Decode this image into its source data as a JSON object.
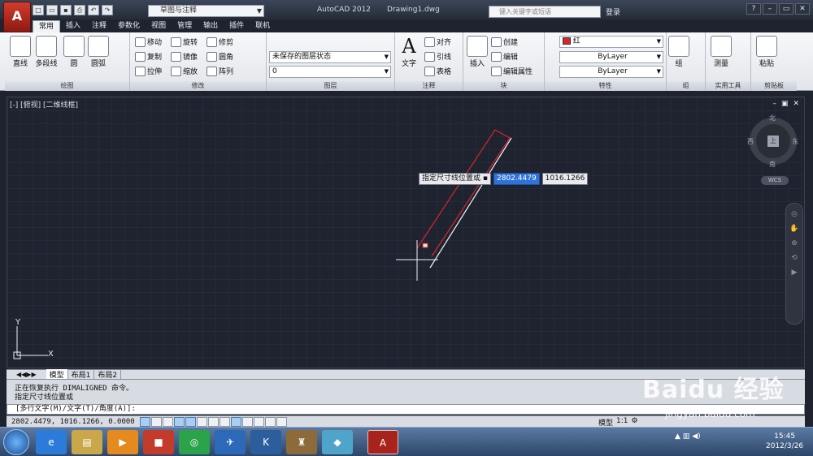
{
  "title": {
    "app": "AutoCAD 2012",
    "file": "Drawing1.dwg",
    "workspace": "草图与注释",
    "search_placeholder": "键入关键字或短语",
    "login": "登录"
  },
  "tabs": [
    "常用",
    "插入",
    "注释",
    "参数化",
    "视图",
    "管理",
    "输出",
    "插件",
    "联机"
  ],
  "ribbon": {
    "draw": {
      "title": "绘图",
      "line": "直线",
      "polyline": "多段线",
      "circle": "圆",
      "arc": "圆弧"
    },
    "modify": {
      "title": "修改",
      "items": [
        "移动",
        "旋转",
        "修剪",
        "复制",
        "镜像",
        "圆角",
        "拉伸",
        "缩放",
        "阵列"
      ]
    },
    "layers": {
      "title": "图层",
      "state": "未保存的图层状态",
      "current": "0"
    },
    "annotation": {
      "title": "注释",
      "text": "文字",
      "align": "对齐",
      "leader": "引线",
      "table": "表格"
    },
    "block": {
      "title": "块",
      "insert": "插入",
      "create": "创建",
      "edit": "编辑",
      "attr": "编辑属性"
    },
    "properties": {
      "title": "特性",
      "color": "红",
      "linetype": "ByLayer",
      "lineweight": "ByLayer"
    },
    "group": {
      "title": "组",
      "label": "组"
    },
    "utilities": {
      "title": "实用工具",
      "measure": "测量"
    },
    "clipboard": {
      "title": "剪贴板",
      "paste": "粘贴"
    }
  },
  "viewport": {
    "label": "[-] [俯视] [二维线框]",
    "north": "北",
    "south": "南",
    "east": "东",
    "west": "西",
    "top": "上",
    "wcs": "WCS"
  },
  "dynamic_input": {
    "prompt": "指定尺寸线位置或",
    "value1": "2802.4479",
    "value2": "1016.1266"
  },
  "layout_tabs": [
    "模型",
    "布局1",
    "布局2"
  ],
  "command": {
    "line1": "正在恢复执行 DIMALIGNED 命令。",
    "line2": "指定尺寸线位置或",
    "input": "[多行文字(M)/文字(T)/角度(A)]:"
  },
  "status": {
    "coords": "2802.4479, 1016.1266, 0.0000",
    "model": "模型",
    "scale": "1:1"
  },
  "clock": {
    "time": "15:45",
    "date": "2012/3/26"
  },
  "watermark": {
    "brand": "Baidu 经验",
    "url": "jingyan.baidu.com"
  },
  "colors": {
    "accent": "#2f73d8",
    "red": "#d6262b",
    "canvas": "#1f2330"
  }
}
